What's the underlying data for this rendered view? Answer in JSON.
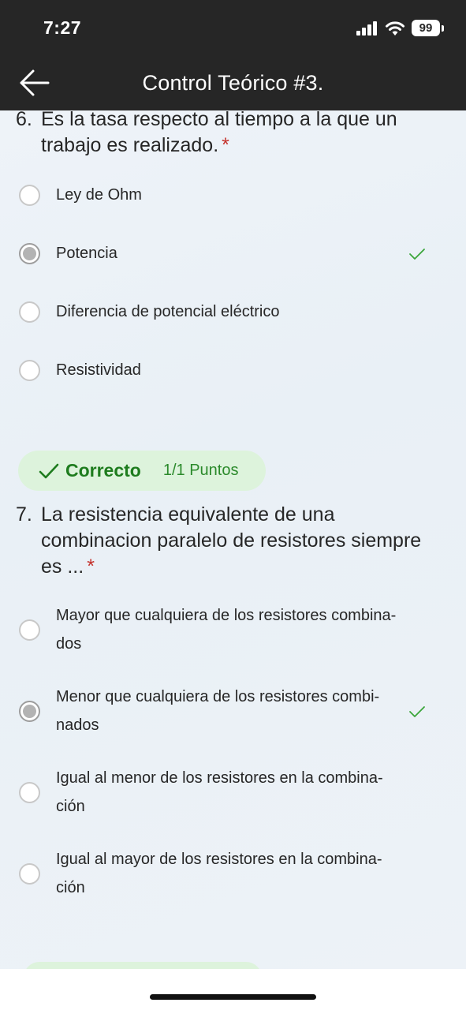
{
  "status_bar": {
    "time": "7:27",
    "battery": "99"
  },
  "app_bar": {
    "title": "Control Teórico #3."
  },
  "questions": [
    {
      "number": "6.",
      "text": "Es la tasa respecto al tiempo a la que un trabajo es realizado.",
      "required_mark": "*",
      "options": [
        {
          "label": "Ley de Ohm"
        },
        {
          "label": "Potencia"
        },
        {
          "label": "Diferencia de potencial eléctrico"
        },
        {
          "label": "Resistividad"
        }
      ],
      "selected_option": "Potencia",
      "result": {
        "status": "Correcto",
        "points": "1/1 Puntos"
      }
    },
    {
      "number": "7.",
      "text": "La resistencia equivalente de una combinacion paralelo de resistores siempre es ...",
      "required_mark": "*",
      "options": [
        {
          "label": "Mayor que cualquiera de los resistores combina-dos"
        },
        {
          "label": "Menor que cualquiera de los resistores combi-nados"
        },
        {
          "label": "Igual al menor de los resistores en la combina-ción"
        },
        {
          "label": "Igual al mayor de los resistores en la combina-ción"
        }
      ],
      "selected_option": "Menor que cualquiera de los resistores combi-nados"
    }
  ],
  "colors": {
    "bar_background": "#262626",
    "content_background": "#eef3f8",
    "correct_green": "#1e7c1e",
    "pill_background": "#ddf3dc",
    "required_red": "#c4312b"
  },
  "icons": [
    "back-arrow-icon",
    "signal-icon",
    "wifi-icon",
    "battery-icon",
    "checkmark-icon"
  ]
}
